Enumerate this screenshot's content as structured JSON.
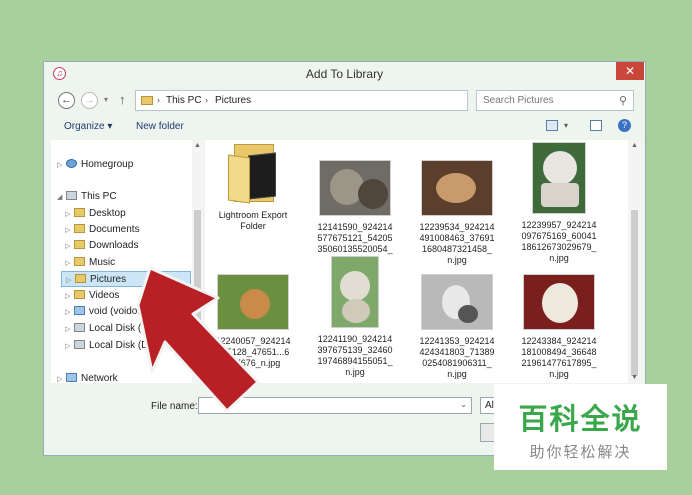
{
  "window": {
    "title": "Add To Library",
    "close_glyph": "✕",
    "app_icon_glyph": "♫"
  },
  "navbar": {
    "path": [
      "This PC",
      "Pictures"
    ],
    "search_placeholder": "Search Pictures"
  },
  "toolbar": {
    "organize": "Organize ▾",
    "new_folder": "New folder"
  },
  "nav_items": [
    {
      "label": "Homegroup",
      "icon": "homegroup-icon"
    },
    {
      "label": "This PC",
      "icon": "computer-icon"
    },
    {
      "label": "Desktop",
      "icon": "folder-icon"
    },
    {
      "label": "Documents",
      "icon": "folder-icon"
    },
    {
      "label": "Downloads",
      "icon": "folder-icon"
    },
    {
      "label": "Music",
      "icon": "folder-icon"
    },
    {
      "label": "Pictures",
      "icon": "folder-icon",
      "selected": true
    },
    {
      "label": "Videos",
      "icon": "folder-icon"
    },
    {
      "label": "void (voidoid)",
      "icon": "user-folder-icon"
    },
    {
      "label": "Local Disk (C:)",
      "icon": "drive-icon"
    },
    {
      "label": "Local Disk (D:)",
      "icon": "drive-icon"
    },
    {
      "label": "Network",
      "icon": "network-icon"
    }
  ],
  "files": [
    {
      "label": "Lightroom Export Folder",
      "kind": "folder"
    },
    {
      "label": "12141590_924214577675121_5420535060135520054_n.jpg",
      "kind": "cat-image"
    },
    {
      "label": "12239534_924214491008463_376911680487321458_n.jpg",
      "kind": "cat-image"
    },
    {
      "label": "12239957_924214097675169_6004118612673029679_n.jpg",
      "kind": "cat-image"
    },
    {
      "label": "12240057_924214175128_47651...6037676_n.jpg",
      "kind": "cat-image"
    },
    {
      "label": "12241190_924214397675139_3246019746894155051_n.jpg",
      "kind": "cat-image"
    },
    {
      "label": "12241353_924214424341803_713890254081906311_n.jpg",
      "kind": "cat-image"
    },
    {
      "label": "12243384_924214181008494_3664821961477617895_n.jpg",
      "kind": "cat-image"
    }
  ],
  "filebar": {
    "file_name_label": "File name:",
    "filter_text": "All"
  },
  "watermark": {
    "main": "百科全说",
    "sub": "助你轻松解决"
  },
  "colors": {
    "background": "#a9d09c",
    "close_red": "#c9473a",
    "arrow_red": "#b92026",
    "watermark_green": "#3aa74a"
  }
}
